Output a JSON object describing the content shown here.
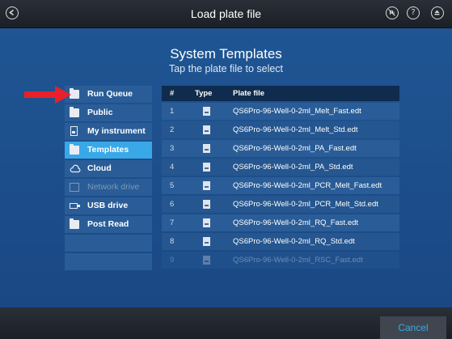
{
  "header": {
    "title": "Load plate file",
    "back_icon": "back-arrow-icon",
    "icons": [
      "hand-icon",
      "help-icon",
      "eject-icon"
    ],
    "help_glyph": "?"
  },
  "main": {
    "heading": "System Templates",
    "subheading": "Tap the plate file to select"
  },
  "sidebar": {
    "items": [
      {
        "label": "Run Queue",
        "icon": "folder-icon",
        "state": "normal"
      },
      {
        "label": "Public",
        "icon": "folder-icon",
        "state": "normal"
      },
      {
        "label": "My instrument",
        "icon": "instrument-icon",
        "state": "normal"
      },
      {
        "label": "Templates",
        "icon": "folder-icon",
        "state": "selected"
      },
      {
        "label": "Cloud",
        "icon": "cloud-icon",
        "state": "normal"
      },
      {
        "label": "Network drive",
        "icon": "network-drive-icon",
        "state": "disabled"
      },
      {
        "label": "USB drive",
        "icon": "usb-icon",
        "state": "normal"
      },
      {
        "label": "Post Read",
        "icon": "folder-icon",
        "state": "normal"
      }
    ]
  },
  "table": {
    "columns": [
      "#",
      "Type",
      "Plate file"
    ],
    "rows": [
      {
        "num": "1",
        "file": "QS6Pro-96-Well-0-2ml_Melt_Fast.edt"
      },
      {
        "num": "2",
        "file": "QS6Pro-96-Well-0-2ml_Melt_Std.edt"
      },
      {
        "num": "3",
        "file": "QS6Pro-96-Well-0-2ml_PA_Fast.edt"
      },
      {
        "num": "4",
        "file": "QS6Pro-96-Well-0-2ml_PA_Std.edt"
      },
      {
        "num": "5",
        "file": "QS6Pro-96-Well-0-2ml_PCR_Melt_Fast.edt"
      },
      {
        "num": "6",
        "file": "QS6Pro-96-Well-0-2ml_PCR_Melt_Std.edt"
      },
      {
        "num": "7",
        "file": "QS6Pro-96-Well-0-2ml_RQ_Fast.edt"
      },
      {
        "num": "8",
        "file": "QS6Pro-96-Well-0-2ml_RQ_Std.edt"
      },
      {
        "num": "9",
        "file": "QS6Pro-96-Well-0-2ml_RSC_Fast.edt"
      }
    ]
  },
  "footer": {
    "cancel_label": "Cancel"
  },
  "colors": {
    "accent": "#38a8e8",
    "annotation_arrow": "#e8202a",
    "background": "#1e4f87"
  }
}
